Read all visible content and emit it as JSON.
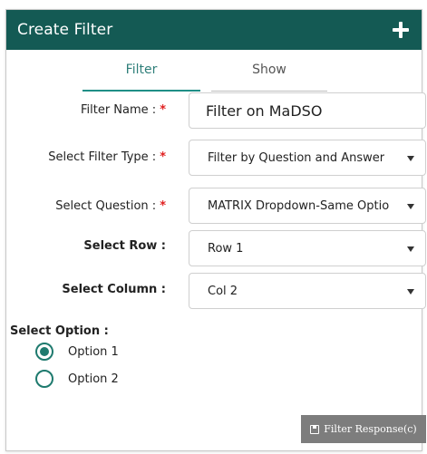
{
  "header": {
    "title": "Create Filter",
    "add_icon": "plus-icon"
  },
  "tabs": [
    {
      "label": "Filter",
      "active": true
    },
    {
      "label": "Show",
      "active": false
    }
  ],
  "form": {
    "filter_name": {
      "label": "Filter Name :",
      "required_mark": "*",
      "value": "Filter on MaDSO"
    },
    "filter_type": {
      "label": "Select Filter Type :",
      "required_mark": "*",
      "value": "Filter by Question and Answer"
    },
    "question": {
      "label": "Select Question :",
      "required_mark": "*",
      "value": "MATRIX Dropdown-Same Options"
    },
    "row": {
      "label": "Select Row :",
      "value": "Row 1"
    },
    "column": {
      "label": "Select Column :",
      "value": "Col 2"
    },
    "option": {
      "label": "Select Option :",
      "choices": [
        {
          "label": "Option 1",
          "selected": true
        },
        {
          "label": "Option 2",
          "selected": false
        }
      ]
    }
  },
  "submit": {
    "label": "Filter Response(c)",
    "icon": "save-icon"
  },
  "colors": {
    "header": "#145a54",
    "accent": "#1f8f87",
    "required": "#e02020",
    "button": "#7d7d7d"
  }
}
